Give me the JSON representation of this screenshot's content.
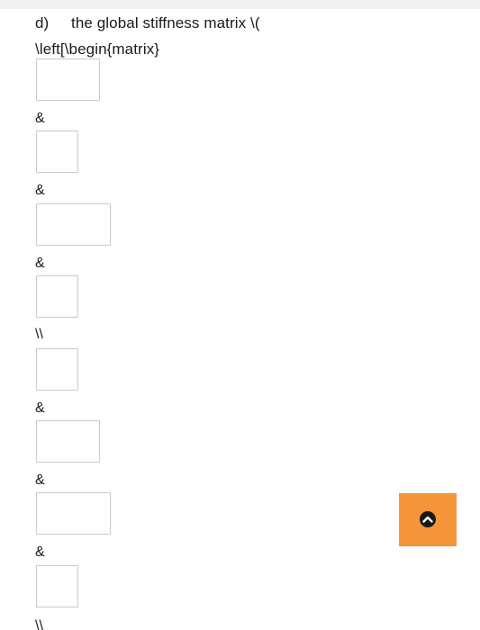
{
  "question": {
    "label": "d)",
    "text_line1": "the global stiffness matrix \\(",
    "text_line2": "\\left[\\begin{matrix}"
  },
  "matrix": {
    "separators": [
      "&",
      "&",
      "&",
      "\\\\",
      "&",
      "&",
      "&",
      "\\\\"
    ]
  },
  "scroll_button": {
    "icon": "chevron-up-icon",
    "color": "#f4953a"
  }
}
